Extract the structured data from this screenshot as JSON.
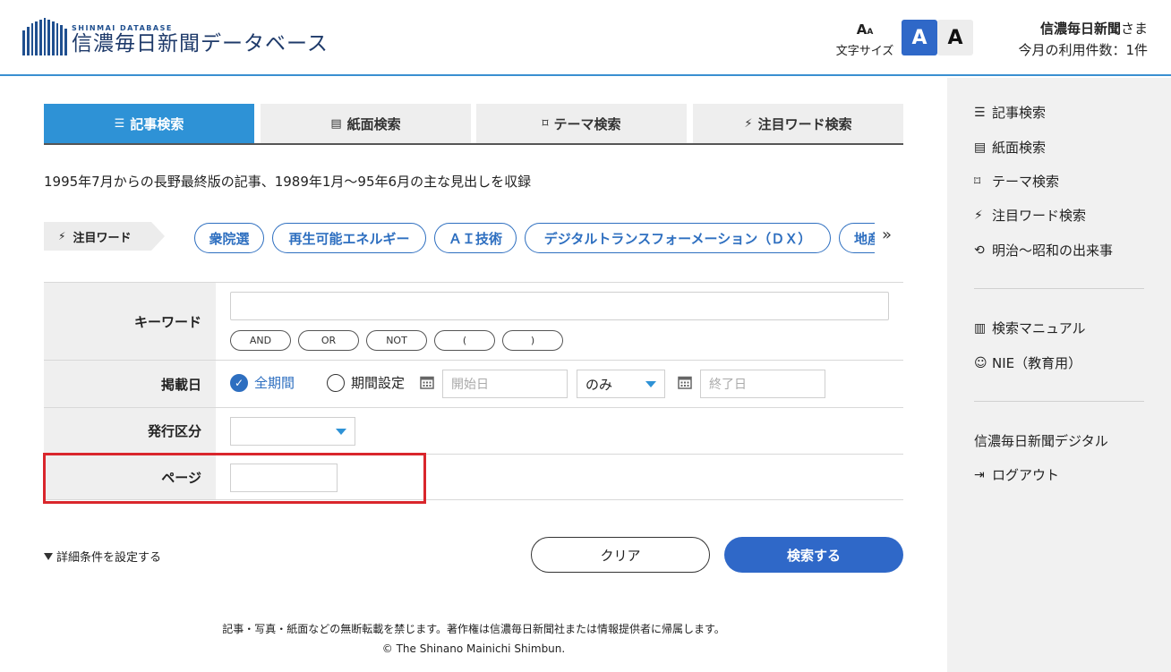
{
  "header": {
    "logo_sub": "SHINMAI DATABASE",
    "logo_title": "信濃毎日新聞データベース",
    "font_size_label": "文字サイズ",
    "font_small_label": "A",
    "font_large_label": "A",
    "user_name": "信濃毎日新聞",
    "user_suffix": "さま",
    "usage_label": "今月の利用件数：1件"
  },
  "tabs": [
    {
      "label": "記事検索",
      "icon": "list-icon",
      "active": true
    },
    {
      "label": "紙面検索",
      "icon": "newspaper-icon",
      "active": false
    },
    {
      "label": "テーマ検索",
      "icon": "bookmark-icon",
      "active": false
    },
    {
      "label": "注目ワード検索",
      "icon": "bolt-icon",
      "active": false
    }
  ],
  "notice": "1995年7月からの長野最終版の記事、1989年1月～95年6月の主な見出しを収録",
  "focus_words": {
    "label": "注目ワード",
    "chips": [
      "衆院選",
      "再生可能エネルギー",
      "ＡＩ技術",
      "デジタルトランスフォーメーション（ＤＸ）",
      "地産地消"
    ]
  },
  "form": {
    "keyword_label": "キーワード",
    "operators": [
      "AND",
      "OR",
      "NOT",
      "(",
      ")"
    ],
    "date_label": "掲載日",
    "date_all": "全期間",
    "date_range": "期間設定",
    "start_placeholder": "開始日",
    "range_mode": "のみ",
    "end_placeholder": "終了日",
    "issue_label": "発行区分",
    "issue_value": "",
    "page_label": "ページ"
  },
  "actions": {
    "detail_toggle": "詳細条件を設定する",
    "clear": "クリア",
    "search": "検索する"
  },
  "sidebar": {
    "items": [
      {
        "label": "記事検索",
        "icon": "list-icon"
      },
      {
        "label": "紙面検索",
        "icon": "newspaper-icon"
      },
      {
        "label": "テーマ検索",
        "icon": "bookmark-icon"
      },
      {
        "label": "注目ワード検索",
        "icon": "bolt-icon"
      },
      {
        "label": "明治～昭和の出来事",
        "icon": "history-icon"
      }
    ],
    "items2": [
      {
        "label": "検索マニュアル",
        "icon": "book-icon"
      },
      {
        "label": "NIE（教育用）",
        "icon": "face-icon"
      }
    ],
    "items3": [
      {
        "label": "信濃毎日新聞デジタル",
        "icon": ""
      },
      {
        "label": "ログアウト",
        "icon": "logout-icon"
      }
    ]
  },
  "footer": {
    "line1": "記事・写真・紙面などの無断転載を禁じます。著作権は信濃毎日新聞社または情報提供者に帰属します。",
    "line2": "© The Shinano Mainichi Shimbun."
  },
  "colors": {
    "accent": "#2e92d6",
    "primary_button": "#2f68c8",
    "highlight": "#d9262c"
  }
}
